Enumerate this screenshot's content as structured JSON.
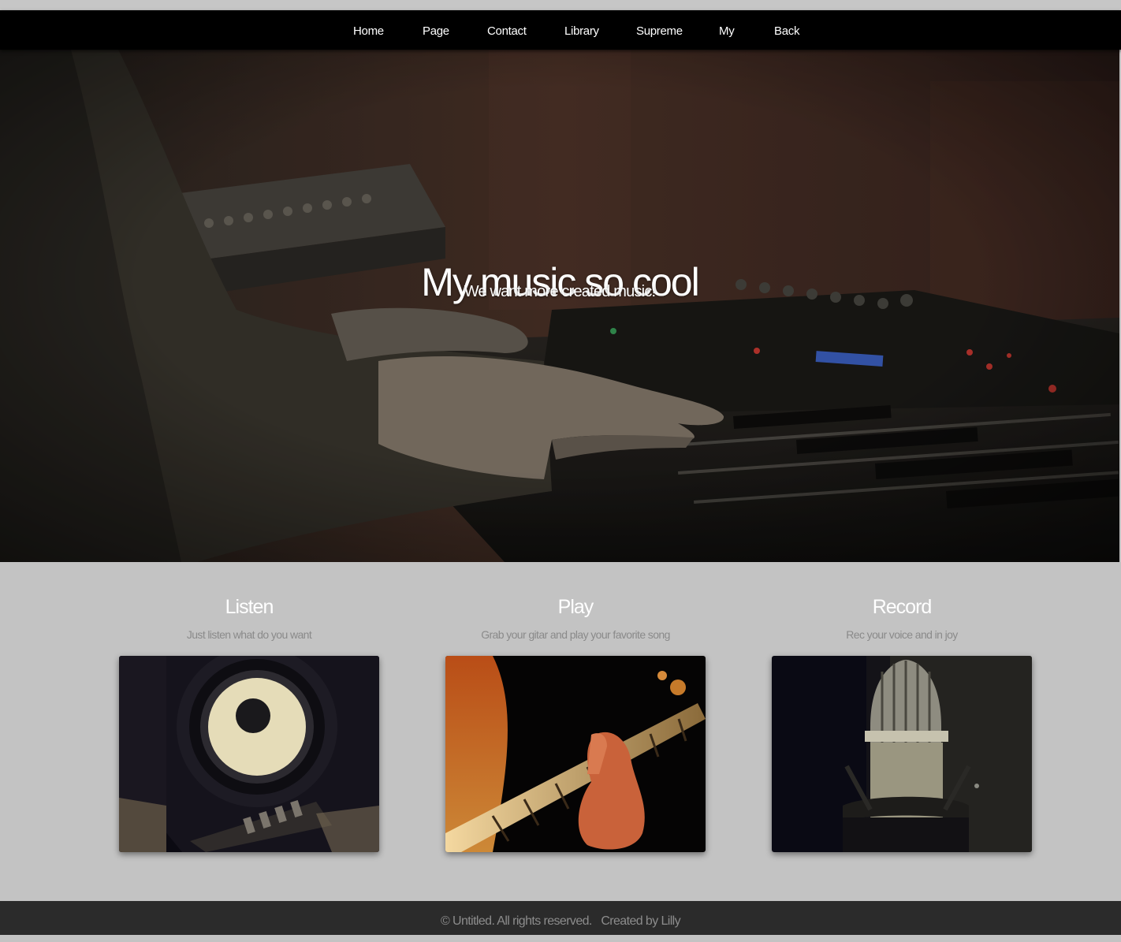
{
  "nav": {
    "items": [
      {
        "label": "Home"
      },
      {
        "label": "Page"
      },
      {
        "label": "Contact"
      },
      {
        "label": "Library"
      },
      {
        "label": "Supreme"
      },
      {
        "label": "My"
      },
      {
        "label": "Back"
      }
    ]
  },
  "hero": {
    "title": "My music so cool",
    "subtitle": "We want more created music!",
    "image": "hands-playing-synthesizer-keyboard"
  },
  "features": [
    {
      "title": "Listen",
      "description": "Just listen what do you want",
      "image": "studio-monitor-speaker"
    },
    {
      "title": "Play",
      "description": "Grab your gitar and play your favorite song",
      "image": "hand-on-guitar-fretboard"
    },
    {
      "title": "Record",
      "description": "Rec your voice and in joy",
      "image": "studio-condenser-microphone"
    }
  ],
  "footer": {
    "copyright": "© Untitled. All rights reserved.",
    "credit": "Created by Lilly"
  }
}
